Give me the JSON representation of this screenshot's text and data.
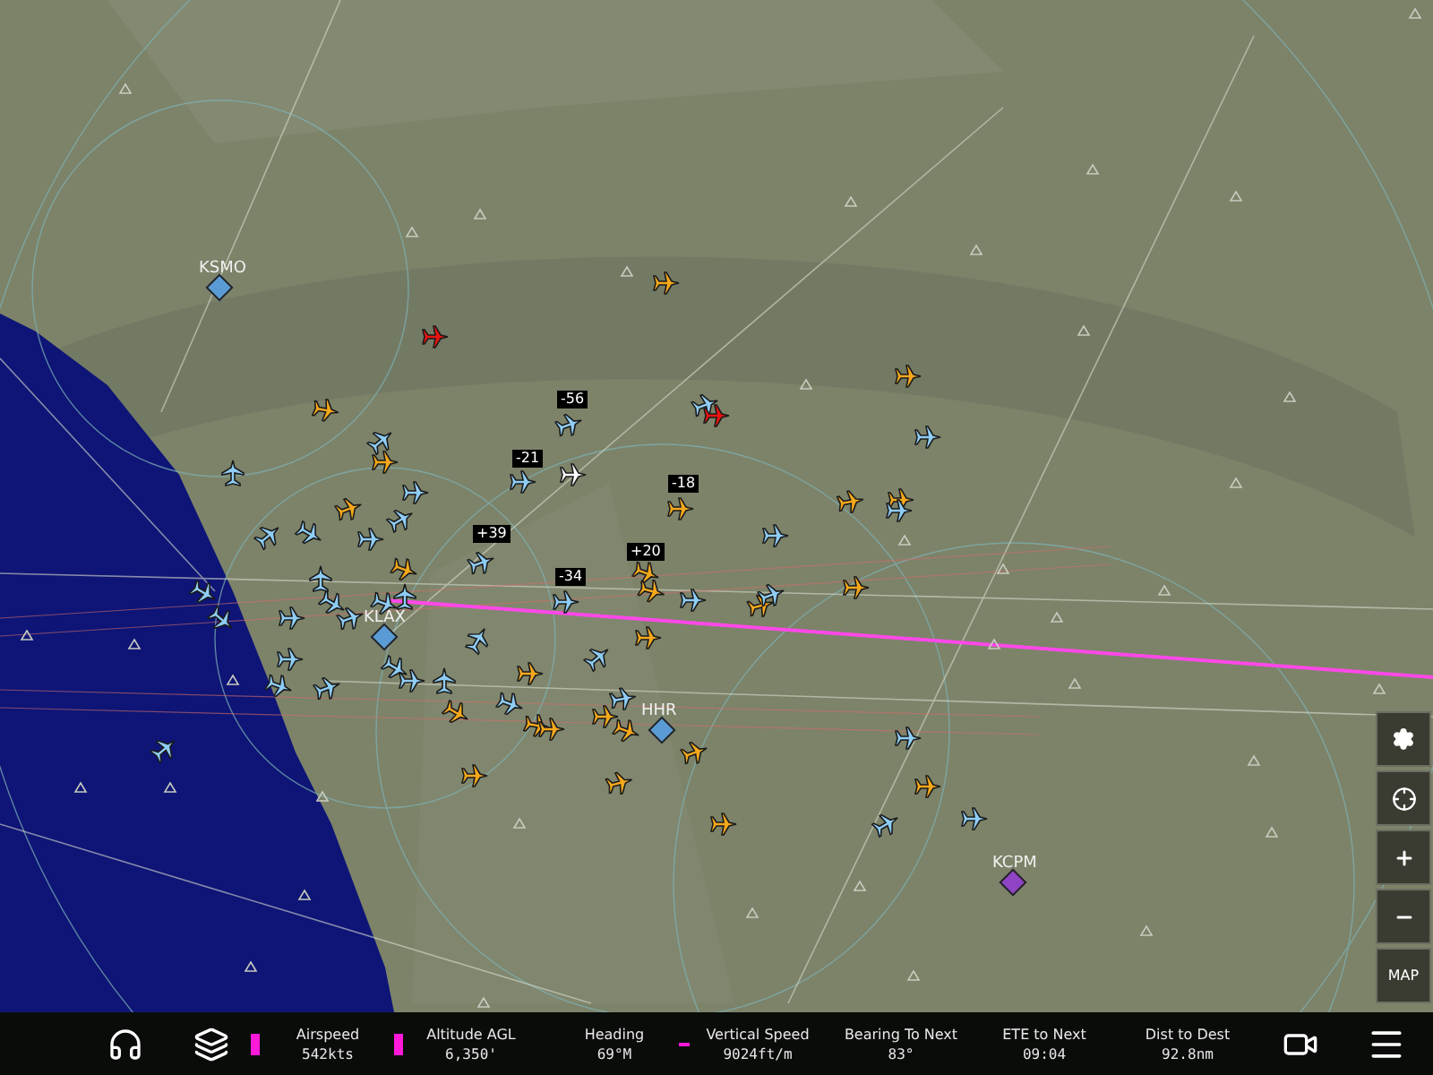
{
  "map": {
    "airports": [
      {
        "label": "KSMO",
        "color": "#5b9bd5"
      },
      {
        "label": "KLAX",
        "color": "#5b9bd5"
      },
      {
        "label": "HHR",
        "color": "#5b9bd5"
      },
      {
        "label": "KCPM",
        "color": "#8e44c4"
      }
    ],
    "altitude_tags": [
      "-56",
      "-21",
      "-18",
      "+39",
      "+20",
      "-34"
    ]
  },
  "controls": [
    {
      "kind": "settings"
    },
    {
      "kind": "locate"
    },
    {
      "kind": "zoom_in"
    },
    {
      "kind": "zoom_out"
    },
    {
      "kind": "map",
      "label": "MAP"
    }
  ],
  "status_bar": [
    {
      "label": "Airspeed",
      "value": "542kts",
      "kind": "bar"
    },
    {
      "label": "Altitude AGL",
      "value": "6,350'",
      "kind": "bar"
    },
    {
      "label": "Heading",
      "value": "69°M",
      "kind": "plain"
    },
    {
      "label": "Vertical Speed",
      "value": "9024ft/m",
      "kind": "dash"
    },
    {
      "label": "Bearing To Next",
      "value": "83°",
      "kind": "plain"
    },
    {
      "label": "ETE to Next",
      "value": "09:04",
      "kind": "plain"
    },
    {
      "label": "Dist to Dest",
      "value": "92.8nm",
      "kind": "plain"
    }
  ]
}
